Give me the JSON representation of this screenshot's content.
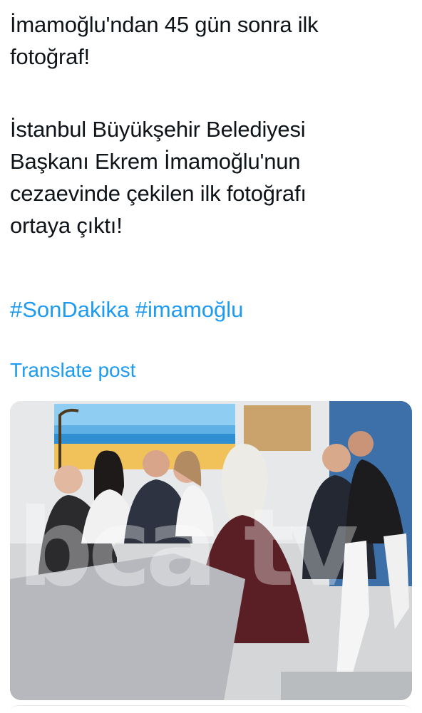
{
  "post": {
    "line1": "İmamoğlu'ndan 45 gün sonra ilk",
    "line2": "fotoğraf!",
    "line3": "İstanbul Büyükşehir Belediyesi",
    "line4": "Başkanı Ekrem İmamoğlu'nun",
    "line5": "cezaevinde çekilen ilk fotoğrafı",
    "line6": "ortaya çıktı!",
    "hashtag1": "#SonDakika",
    "hashtag2": "#imamoğlu",
    "translate_label": "Translate post"
  },
  "media": {
    "watermark": "bca tv"
  },
  "colors": {
    "link": "#1d9bf0",
    "text": "#0f1419"
  }
}
